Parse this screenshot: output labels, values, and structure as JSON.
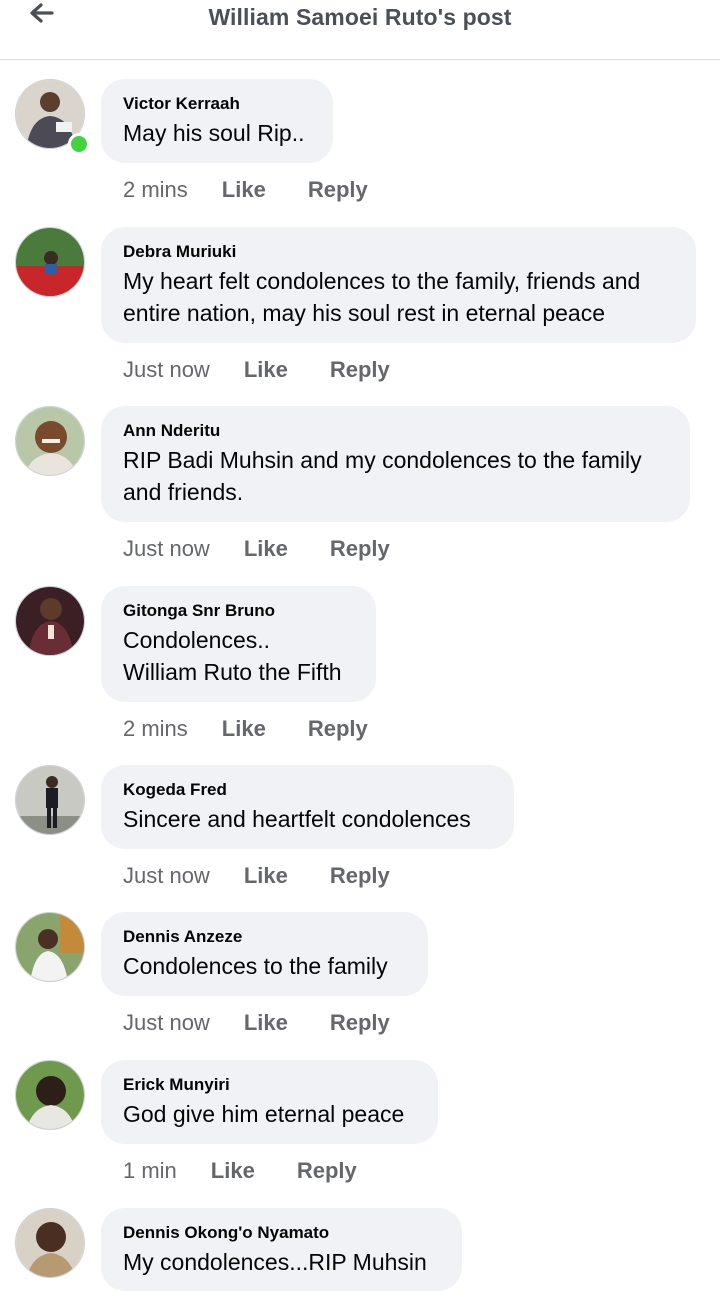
{
  "header": {
    "title": "William Samoei Ruto's post"
  },
  "actions": {
    "like": "Like",
    "reply": "Reply"
  },
  "comments": [
    {
      "author": "Victor Kerraah",
      "text": "May his soul Rip..",
      "time": "2 mins"
    },
    {
      "author": "Debra Muriuki",
      "text": "My heart felt condolences to the family, friends and entire nation, may his soul rest in eternal peace",
      "time": "Just now"
    },
    {
      "author": "Ann Nderitu",
      "text": "RIP Badi Muhsin and my condolences to the family and friends.",
      "time": "Just now"
    },
    {
      "author": "Gitonga Snr Bruno",
      "text": "Condolences..\nWilliam Ruto the Fifth",
      "time": "2 mins"
    },
    {
      "author": "Kogeda Fred",
      "text": "Sincere and heartfelt condolences",
      "time": "Just now"
    },
    {
      "author": "Dennis Anzeze",
      "text": "Condolences to the family",
      "time": "Just now"
    },
    {
      "author": "Erick Munyiri",
      "text": "God give him eternal peace",
      "time": "1 min"
    },
    {
      "author": "Dennis Okong'o Nyamato",
      "text": "My condolences...RIP Muhsin",
      "time": ""
    }
  ],
  "colors": {
    "bubble": "#f0f2f5",
    "online": "#42d23e",
    "secondary_text": "#65676b"
  }
}
